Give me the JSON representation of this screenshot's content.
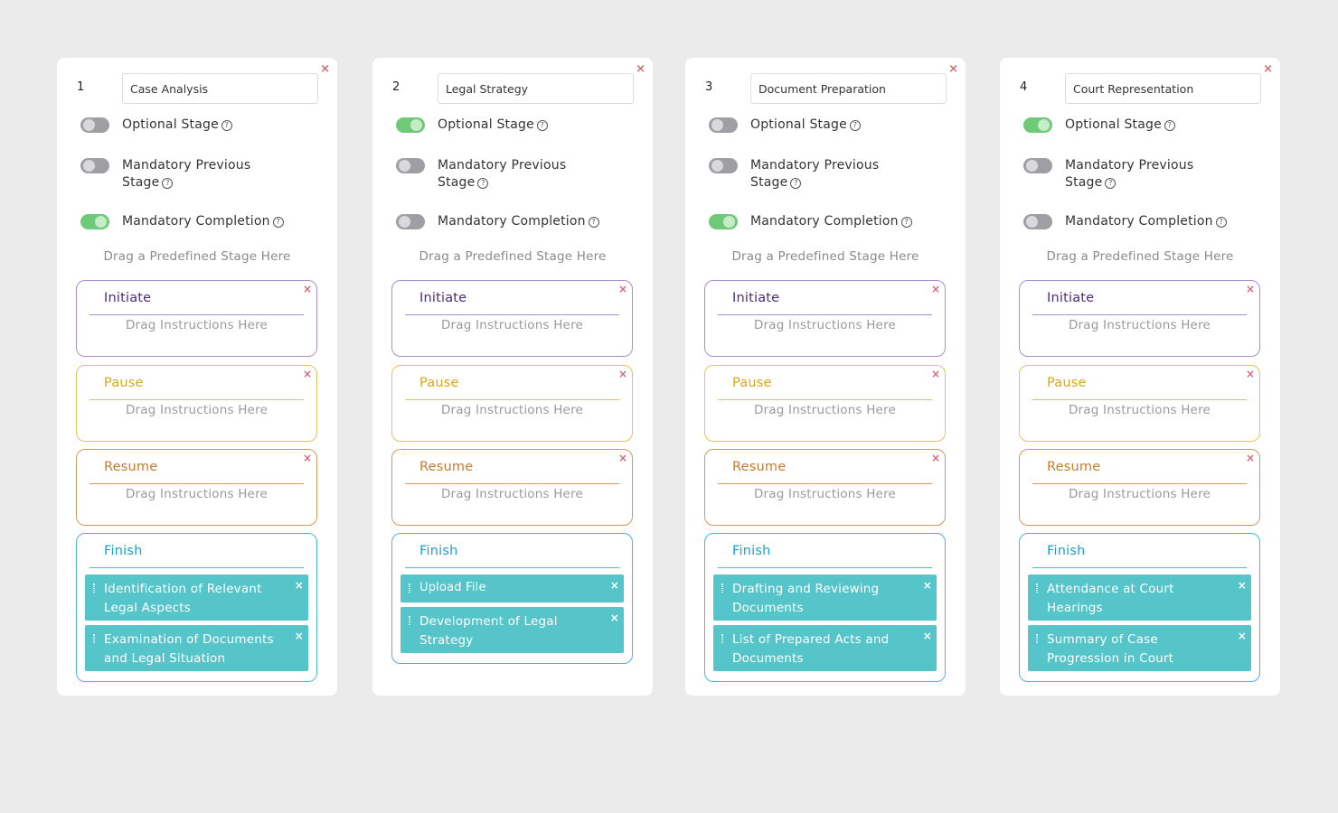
{
  "labels": {
    "optional_stage": "Optional Stage",
    "mandatory_previous": "Mandatory Previous Stage",
    "mandatory_completion": "Mandatory Completion",
    "drag_stage_hint": "Drag a Predefined Stage Here",
    "drag_instructions_hint": "Drag Instructions Here",
    "help_glyph": "?",
    "close_glyph": "×"
  },
  "sections": {
    "initiate": "Initiate",
    "pause": "Pause",
    "resume": "Resume",
    "finish": "Finish"
  },
  "icons": {
    "close": "close-icon",
    "help": "help-circle-icon",
    "drag": "drag-handle-icon"
  },
  "colors": {
    "toggle_on": "#6fca78",
    "toggle_off": "#9e9ea3",
    "instruction_bg": "#55c5ca",
    "close": "#d26a78",
    "initiate": "#a98fcf",
    "pause": "#e4c35c",
    "resume": "#d39a5c",
    "finish": "#4bb4d8"
  },
  "stages": [
    {
      "number": "1",
      "name": "Case Analysis",
      "optional_stage": false,
      "mandatory_previous": false,
      "mandatory_completion": true,
      "finish_instructions": [
        "Identification of Relevant Legal Aspects",
        "Examination of Documents and Legal Situation"
      ]
    },
    {
      "number": "2",
      "name": "Legal Strategy",
      "optional_stage": true,
      "mandatory_previous": false,
      "mandatory_completion": false,
      "finish_instructions": [
        "Upload File",
        "Development of Legal Strategy"
      ]
    },
    {
      "number": "3",
      "name": "Document Preparation",
      "optional_stage": false,
      "mandatory_previous": false,
      "mandatory_completion": true,
      "finish_instructions": [
        "Drafting and Reviewing Documents",
        "List of Prepared Acts and Documents"
      ]
    },
    {
      "number": "4",
      "name": "Court Representation",
      "optional_stage": true,
      "mandatory_previous": false,
      "mandatory_completion": false,
      "finish_instructions": [
        "Attendance at Court Hearings",
        "Summary of Case Progression in Court"
      ]
    }
  ]
}
